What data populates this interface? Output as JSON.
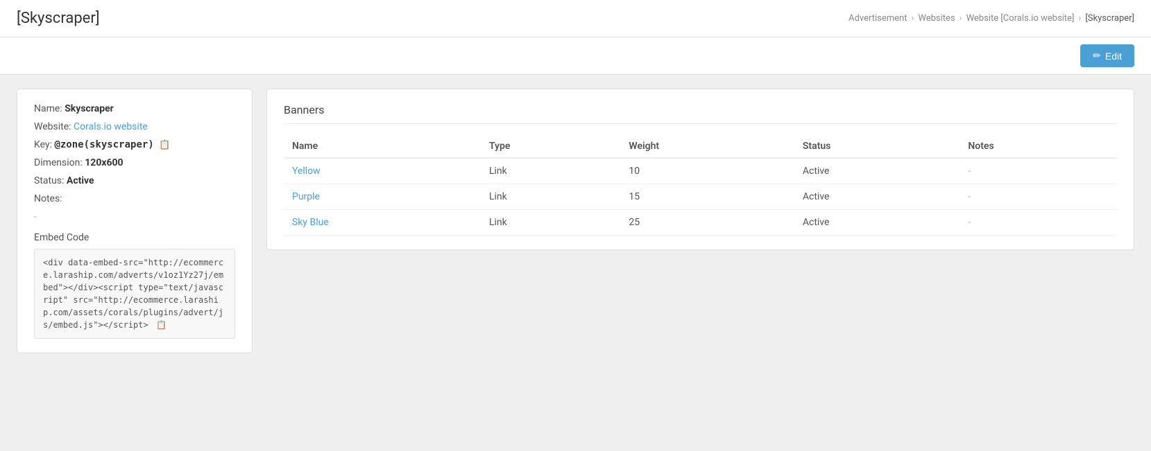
{
  "header": {
    "title": "[Skyscraper]",
    "breadcrumbs": [
      {
        "label": "Advertisement",
        "link": true
      },
      {
        "label": "Websites",
        "link": true
      },
      {
        "label": "Website [Corals.io website]",
        "link": true
      },
      {
        "label": "[Skyscraper]",
        "link": false
      }
    ]
  },
  "toolbar": {
    "edit_label": "Edit"
  },
  "detail": {
    "name_label": "Name:",
    "name_value": "Skyscraper",
    "website_label": "Website:",
    "website_value": "Corals.io website",
    "key_label": "Key:",
    "key_value": "@zone(skyscraper)",
    "dimension_label": "Dimension:",
    "dimension_value": "120x600",
    "status_label": "Status:",
    "status_value": "Active",
    "notes_label": "Notes:",
    "notes_value": "-",
    "embed_label": "Embed Code",
    "embed_code": "<div data-embed-src=\"http://ecommerce.laraship.com/adverts/v1oz1Yz27j/embed\"></div><script type=\"text/javascript\" src=\"http://ecommerce.laraship.com/assets/corals/plugins/advert/js/embed.js\"></script>"
  },
  "banners": {
    "section_title": "Banners",
    "columns": [
      "Name",
      "Type",
      "Weight",
      "Status",
      "Notes"
    ],
    "rows": [
      {
        "name": "Yellow",
        "type": "Link",
        "weight": "10",
        "status": "Active",
        "notes": "-"
      },
      {
        "name": "Purple",
        "type": "Link",
        "weight": "15",
        "status": "Active",
        "notes": "-"
      },
      {
        "name": "Sky Blue",
        "type": "Link",
        "weight": "25",
        "status": "Active",
        "notes": "-"
      }
    ]
  }
}
